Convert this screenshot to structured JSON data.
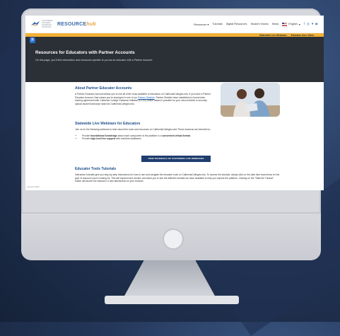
{
  "site": {
    "logo_small": "CALIFORNIA COLLEGE GUIDANCE INITIATIVE",
    "logo_resource": "RESOURCE",
    "logo_hub": "hub"
  },
  "nav": {
    "items": [
      "Resources",
      "Tutorials",
      "Digital Resources",
      "Student Voices",
      "News"
    ],
    "language": "English",
    "social_icons": [
      "facebook-icon",
      "instagram-icon",
      "twitter-icon",
      "youtube-icon"
    ]
  },
  "subbar": {
    "links": [
      "Statewide Live Webinars",
      "Educator User Video"
    ]
  },
  "hero": {
    "title": "Resources for Educators with Partner Accounts",
    "description": "On this page, you'll find information and resources specific to you as an educator with a Partner Account."
  },
  "about": {
    "heading": "About Partner Educator Accounts",
    "text_1": "A Partner Educator Account allows you to use all of the tools available to educators on CaliforniaColleges.edu. If you have a Partner Educator Account, that means you're employed in one of our",
    "link": "Partner Districts",
    "text_2": ". Partner Districts have established a formal data sharing agreement with California College Guidance Initiative (CCGI), which makes it possible for your school district to securely upload student transcript data into CaliforniaColleges.edu."
  },
  "webinars": {
    "heading": "Statewide Live Webinars for Educators",
    "intro": "Join us for the following webinars to learn about the tools and resources on CaliforniaColleges.edu! These sessions are intended to:",
    "bullet_1_pre": "Provide ",
    "bullet_1_bold": "foundational knowledge",
    "bullet_1_mid": " about each component of the platform in a ",
    "bullet_1_bold2": "convenient virtual format.",
    "bullet_2_pre": "Provide ",
    "bullet_2_bold": "high-level live support",
    "bullet_2_post": " with real-time facilitators.",
    "button": "VIEW SCHEDULE OF STATEWIDE LIVE WEBINARS"
  },
  "tutorials": {
    "heading": "Educator Tools Tutorials",
    "text": "Interactive tutorials give you step-by-step instructions for how to use and navigate the educator tools on CaliforniaColleges.edu. To access the tutorials, simply click on the dark blue bars below for the type of resource you're looking for. This will expand each section and allow you to see the different tutorials we have available to help you explore the platform. Clicking on the \"Start the Tutorial\" button will launch the tutorial in a new tab/window on your browser."
  },
  "status": "resource.edu/#",
  "colors": {
    "brand_blue": "#1d4d8a",
    "accent_yellow": "#f2b135",
    "hero_dark": "#2b2f36",
    "button_navy": "#1f3d6e"
  }
}
